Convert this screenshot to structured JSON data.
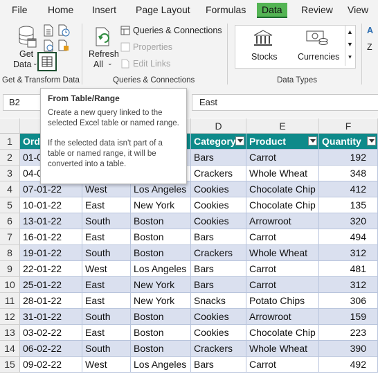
{
  "menu": {
    "tabs": [
      {
        "label": "File",
        "active": false
      },
      {
        "label": "Home",
        "active": false
      },
      {
        "label": "Insert",
        "active": false
      },
      {
        "label": "Page Layout",
        "active": false
      },
      {
        "label": "Formulas",
        "active": false
      },
      {
        "label": "Data",
        "active": true
      },
      {
        "label": "Review",
        "active": false
      },
      {
        "label": "View",
        "active": false
      }
    ]
  },
  "ribbon": {
    "get_data_line1": "Get",
    "get_data_line2": "Data",
    "get_transform_group": "Get & Transform Data",
    "refresh_line1": "Refresh",
    "refresh_line2": "All",
    "queries_connections": "Queries & Connections",
    "properties": "Properties",
    "edit_links": "Edit Links",
    "queries_group": "Queries & Connections",
    "stocks": "Stocks",
    "currencies": "Currencies",
    "data_types_group": "Data Types",
    "accent_color": "#1d6b2e"
  },
  "formula_bar": {
    "name_box": "B2",
    "value": "East"
  },
  "tooltip": {
    "title": "From Table/Range",
    "para1": "Create a new query linked to the selected Excel table or named range.",
    "para2": "If the selected data isn't part of a table or named range, it will be converted into a table."
  },
  "grid": {
    "column_headers": [
      "D",
      "E",
      "F"
    ],
    "row_numbers": [
      "1",
      "2",
      "3",
      "4",
      "5",
      "6",
      "7",
      "8",
      "9",
      "10",
      "11",
      "12",
      "13",
      "14",
      "15"
    ],
    "table_headers": [
      "Ord",
      "Category",
      "Product",
      "Quantity"
    ],
    "header_color": "#0e8a8a",
    "band_color": "#dae0ef",
    "rows": [
      [
        "01-0",
        "",
        "",
        "Bars",
        "Carrot",
        "192"
      ],
      [
        "04-0",
        "",
        "",
        "Crackers",
        "Whole Wheat",
        "348"
      ],
      [
        "07-01-22",
        "West",
        "Los Angeles",
        "Cookies",
        "Chocolate Chip",
        "412"
      ],
      [
        "10-01-22",
        "East",
        "New York",
        "Cookies",
        "Chocolate Chip",
        "135"
      ],
      [
        "13-01-22",
        "South",
        "Boston",
        "Cookies",
        "Arrowroot",
        "320"
      ],
      [
        "16-01-22",
        "East",
        "Boston",
        "Bars",
        "Carrot",
        "494"
      ],
      [
        "19-01-22",
        "South",
        "Boston",
        "Crackers",
        "Whole Wheat",
        "312"
      ],
      [
        "22-01-22",
        "West",
        "Los Angeles",
        "Bars",
        "Carrot",
        "481"
      ],
      [
        "25-01-22",
        "East",
        "New York",
        "Bars",
        "Carrot",
        "312"
      ],
      [
        "28-01-22",
        "East",
        "New York",
        "Snacks",
        "Potato Chips",
        "306"
      ],
      [
        "31-01-22",
        "South",
        "Boston",
        "Cookies",
        "Arrowroot",
        "159"
      ],
      [
        "03-02-22",
        "East",
        "Boston",
        "Cookies",
        "Chocolate Chip",
        "223"
      ],
      [
        "06-02-22",
        "South",
        "Boston",
        "Crackers",
        "Whole Wheat",
        "390"
      ],
      [
        "09-02-22",
        "West",
        "Los Angeles",
        "Bars",
        "Carrot",
        "492"
      ]
    ]
  }
}
